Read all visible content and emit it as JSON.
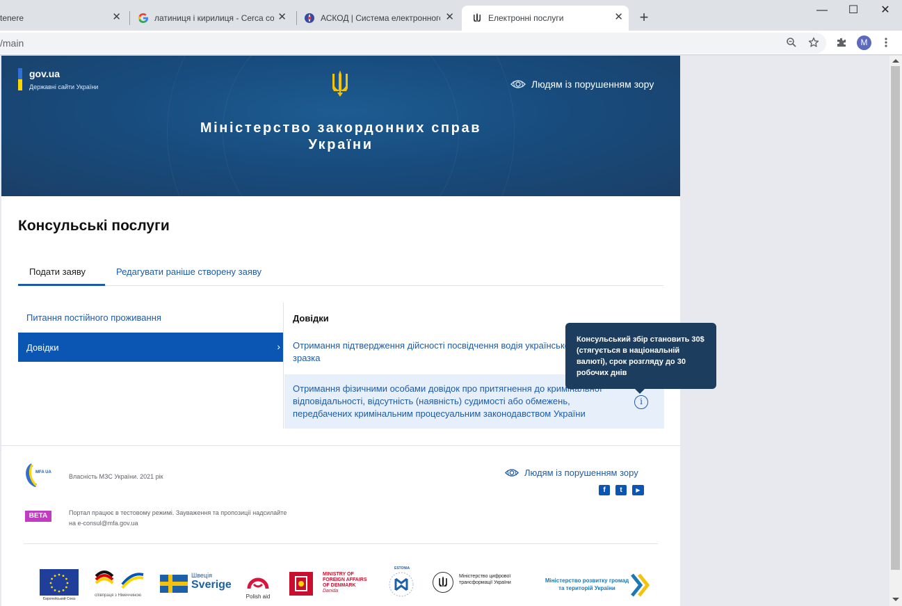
{
  "browser": {
    "tabs": [
      {
        "title": "tenere",
        "active": false
      },
      {
        "title": "латиниця і кирилиця - Cerca con",
        "active": false
      },
      {
        "title": "АСКОД | Система електронного",
        "active": false
      },
      {
        "title": "Електронні послуги",
        "active": true
      }
    ],
    "new_tab_label": "+",
    "url": "/main",
    "profile_initial": "M",
    "window_buttons": {
      "minimize": "—",
      "maximize": "☐",
      "close": "✕"
    }
  },
  "header": {
    "govua_title": "gov.ua",
    "govua_subtitle": "Державні сайти України",
    "vision_link": "Людям із порушенням зору",
    "ministry_line1": "Міністерство закордонних справ",
    "ministry_line2": "України"
  },
  "main": {
    "page_title": "Консульські послуги",
    "tabs": [
      {
        "label": "Подати заяву",
        "active": true
      },
      {
        "label": "Редагувати раніше створену заяву",
        "active": false
      }
    ],
    "categories": [
      {
        "label": "Питання постійного проживання",
        "selected": false
      },
      {
        "label": "Довідки",
        "selected": true,
        "chevron": "›"
      }
    ],
    "panel_heading": "Довідки",
    "services": [
      {
        "label": "Отримання підтвердження дійсності посвідчення водія українського зразка"
      },
      {
        "label": "Отримання фізичними особами довідок про притягнення до кримінальної відповідальності, відсутність (наявність) судимості або обмежень, передбачених кримінальним процесуальним законодавством України",
        "info_icon": "i"
      }
    ],
    "tooltip": "Консульський збір становить 30$ (стягується в національній валюті), срок розгляду до 30 робочих днів"
  },
  "footer": {
    "mfa_logo_text": "MFA UA",
    "owner": "Власність МЗС України. 2021 рік",
    "vision_link": "Людям із порушенням зору",
    "beta_badge": "BETA",
    "beta_note": "Портал працює в тестовому режимі. Зауваження та пропозиції надсилайте на e-consul@mfa.gov.ua",
    "social": [
      {
        "name": "facebook-icon",
        "glyph": "f"
      },
      {
        "name": "twitter-icon",
        "glyph": "t"
      },
      {
        "name": "youtube-icon",
        "glyph": "▶"
      }
    ],
    "partners": {
      "eu": "Європейський Союз",
      "giz": "співпраця з Німеччиною",
      "sweden_1": "Швеція",
      "sweden_2": "Sverige",
      "polish_aid": "Polish aid",
      "denmark": "MINISTRY OF FOREIGN AFFAIRS OF DENMARK",
      "danida": "Danida",
      "estonia": "ESTONIA",
      "digital_ministry": "Міністерство цифрової трансформації України",
      "regional_ministry": "Міністерство розвитку громад та територій України"
    }
  },
  "colors": {
    "banner": "#184c7e",
    "accent_blue": "#0b55b3",
    "link_blue": "#1d5ba8",
    "tooltip_bg": "#1d3d5f",
    "beta": "#c23bc3"
  }
}
